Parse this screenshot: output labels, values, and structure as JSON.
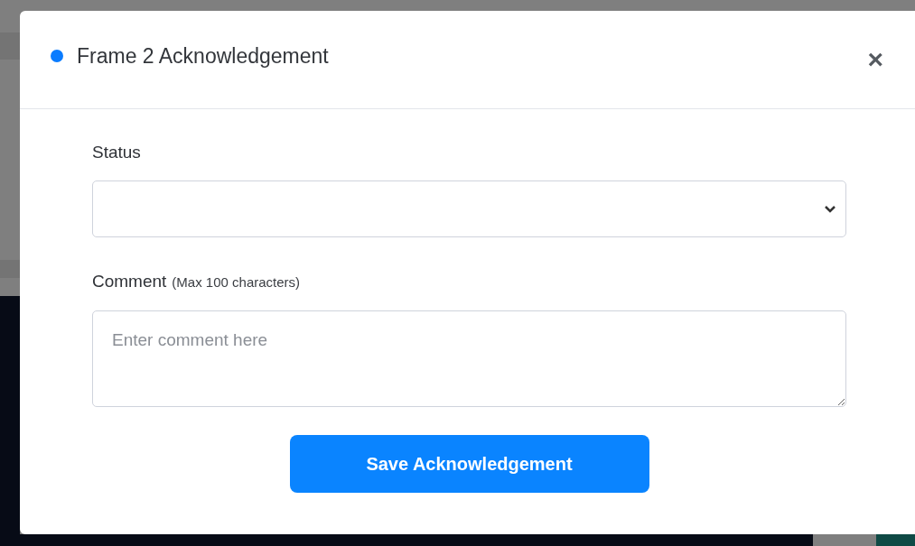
{
  "dialog": {
    "title": "Frame 2 Acknowledgement",
    "close": "×"
  },
  "status": {
    "label": "Status"
  },
  "comment": {
    "label": "Comment",
    "hint": "(Max 100 characters)",
    "placeholder": "Enter comment here"
  },
  "save_button": "Save Acknowledgement"
}
